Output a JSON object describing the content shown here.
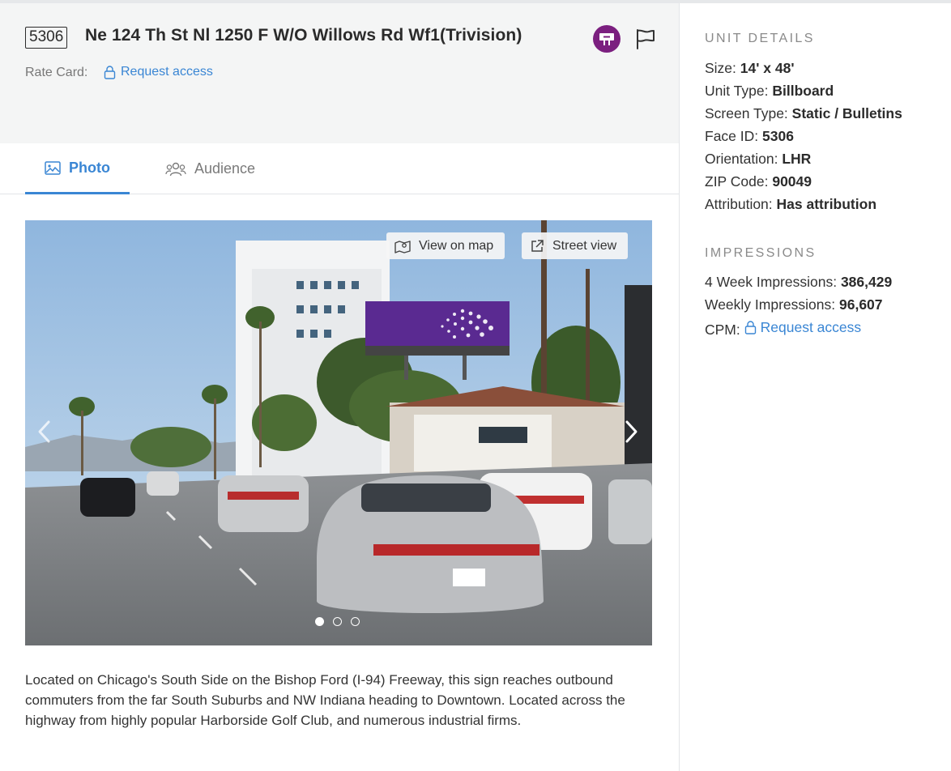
{
  "header": {
    "face_badge": "5306",
    "title": "Ne 124 Th St Nl 1250 F W/O Willows Rd Wf1(Trivision)",
    "rate_card_label": "Rate Card:",
    "rate_card_link": "Request access"
  },
  "tabs": [
    {
      "label": "Photo",
      "active": true
    },
    {
      "label": "Audience",
      "active": false
    }
  ],
  "photo": {
    "view_on_map": "View on map",
    "street_view": "Street view",
    "slides": 3,
    "active_slide": 1
  },
  "description": "Located on Chicago's South Side on the Bishop Ford (I-94) Freeway, this sign reaches outbound commuters from the far South Suburbs and NW Indiana heading to Downtown. Located across the highway from highly popular Harborside Golf Club, and numerous industrial firms.",
  "unit_details": {
    "title": "UNIT DETAILS",
    "size_label": "Size:",
    "size_value": "14' x 48'",
    "unit_type_label": "Unit Type:",
    "unit_type_value": "Billboard",
    "screen_type_label": "Screen Type:",
    "screen_type_value": "Static / Bulletins",
    "face_id_label": "Face ID:",
    "face_id_value": "5306",
    "orientation_label": "Orientation:",
    "orientation_value": "LHR",
    "zip_label": "ZIP Code:",
    "zip_value": "90049",
    "attribution_label": "Attribution:",
    "attribution_value": "Has attribution"
  },
  "impressions": {
    "title": "IMPRESSIONS",
    "four_week_label": "4 Week Impressions:",
    "four_week_value": "386,429",
    "weekly_label": "Weekly Impressions:",
    "weekly_value": "96,607",
    "cpm_label": "CPM:",
    "cpm_link": "Request access"
  },
  "colors": {
    "accent": "#3a86d4",
    "unit_type_badge": "#7b1f7f",
    "header_bg": "#f4f5f5"
  },
  "icons": {
    "lock": "lock-icon",
    "billboard": "billboard-icon",
    "flag": "flag-icon",
    "photo_tab": "image-icon",
    "audience_tab": "users-icon",
    "map": "map-icon",
    "street": "external-link-icon"
  }
}
